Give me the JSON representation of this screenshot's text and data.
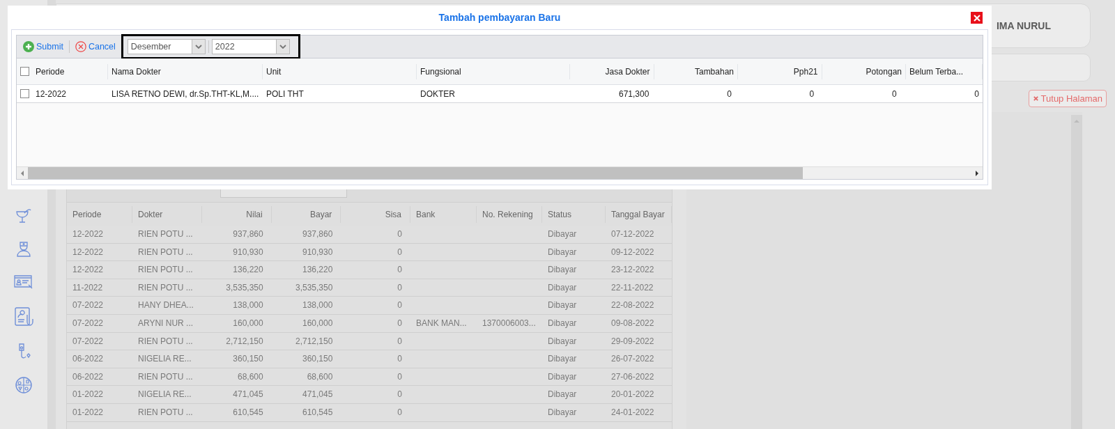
{
  "header": {
    "user_name": "IMA NURUL"
  },
  "close_page_button": {
    "label": "Tutup Halaman"
  },
  "background_table": {
    "columns": [
      {
        "label": "Periode"
      },
      {
        "label": "Dokter"
      },
      {
        "label": "Nilai"
      },
      {
        "label": "Bayar"
      },
      {
        "label": "Sisa"
      },
      {
        "label": "Bank"
      },
      {
        "label": "No. Rekening"
      },
      {
        "label": "Status"
      },
      {
        "label": "Tanggal Bayar"
      }
    ],
    "rows": [
      [
        "12-2022",
        "RIEN POTU ...",
        "937,860",
        "937,860",
        "0",
        "",
        "",
        "Dibayar",
        "07-12-2022"
      ],
      [
        "12-2022",
        "RIEN POTU ...",
        "910,930",
        "910,930",
        "0",
        "",
        "",
        "Dibayar",
        "09-12-2022"
      ],
      [
        "12-2022",
        "RIEN POTU ...",
        "136,220",
        "136,220",
        "0",
        "",
        "",
        "Dibayar",
        "23-12-2022"
      ],
      [
        "11-2022",
        "RIEN POTU ...",
        "3,535,350",
        "3,535,350",
        "0",
        "",
        "",
        "Dibayar",
        "22-11-2022"
      ],
      [
        "07-2022",
        "HANY DHEA...",
        "138,000",
        "138,000",
        "0",
        "",
        "",
        "Dibayar",
        "22-08-2022"
      ],
      [
        "07-2022",
        "ARYNI NUR ...",
        "160,000",
        "160,000",
        "0",
        "BANK MAN...",
        "1370006003...",
        "Dibayar",
        "09-08-2022"
      ],
      [
        "07-2022",
        "RIEN POTU ...",
        "2,712,150",
        "2,712,150",
        "0",
        "",
        "",
        "Dibayar",
        "29-09-2022"
      ],
      [
        "06-2022",
        "NIGELIA RE...",
        "360,150",
        "360,150",
        "0",
        "",
        "",
        "Dibayar",
        "26-07-2022"
      ],
      [
        "06-2022",
        "RIEN POTU ...",
        "68,600",
        "68,600",
        "0",
        "",
        "",
        "Dibayar",
        "27-06-2022"
      ],
      [
        "01-2022",
        "NIGELIA RE...",
        "471,045",
        "471,045",
        "0",
        "",
        "",
        "Dibayar",
        "20-01-2022"
      ],
      [
        "01-2022",
        "RIEN POTU ...",
        "610,545",
        "610,545",
        "0",
        "",
        "",
        "Dibayar",
        "24-01-2022"
      ]
    ]
  },
  "modal": {
    "title": "Tambah pembayaran Baru",
    "toolbar": {
      "buttons": [
        {
          "label": "Submit",
          "kind": "add"
        },
        {
          "label": "Cancel",
          "kind": "cancel"
        }
      ],
      "selects_highlighted": true,
      "selects": [
        {
          "value": "Desember"
        },
        {
          "value": "2022"
        }
      ]
    },
    "table": {
      "header_checked": false,
      "columns": [
        {
          "label": "Periode"
        },
        {
          "label": "Nama Dokter"
        },
        {
          "label": "Unit"
        },
        {
          "label": "Fungsional"
        },
        {
          "label": "Jasa Dokter"
        },
        {
          "label": "Tambahan"
        },
        {
          "label": "Pph21"
        },
        {
          "label": "Potongan"
        },
        {
          "label": "Belum Terba..."
        }
      ],
      "rows": [
        {
          "checked": false,
          "cells": [
            "12-2022",
            "LISA RETNO DEWI, dr.Sp.THT-KL,M....",
            "POLI THT",
            "DOKTER",
            "671,300",
            "0",
            "0",
            "0",
            "0"
          ]
        }
      ]
    }
  }
}
